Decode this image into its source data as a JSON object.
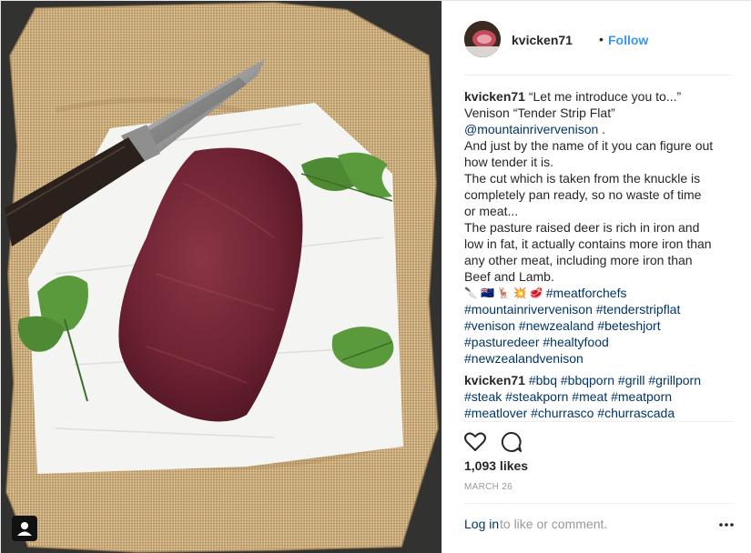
{
  "header": {
    "username": "kvicken71",
    "separator": "•",
    "follow_label": "Follow"
  },
  "caption": {
    "username": "kvicken71",
    "lines": [
      "“Let me introduce you to...”",
      "Venison “Tender Strip Flat”",
      "@mountainrivervenison",
      ".",
      "And just by the name of it you can figure out",
      "how tender it is.",
      "The cut which is taken from the knuckle is",
      "completely pan ready, so no waste of time",
      "or meat...",
      "The pasture raised deer is rich in iron and",
      "low in fat, it actually contains more iron than",
      "any other meat, including more iron than",
      "Beef and Lamb."
    ],
    "emojis": [
      "🔪",
      "🇳🇿",
      "🦌",
      "💥",
      "🥩"
    ],
    "hashtags": [
      "#meatforchefs",
      "#mountainrivervenison #tenderstripflat",
      "#venison #newzealand #beteshjort",
      "#pasturedeer #healtyfood",
      "#newzealandvenison"
    ]
  },
  "comment2": {
    "username": "kvicken71",
    "lines": [
      "#bbq #bbqporn #grill #grillporn",
      "#steak #steakporn #meat #meatporn",
      "#meatlover #churrasco #churrascada"
    ]
  },
  "actions": {
    "like_icon": "heart-icon",
    "comment_icon": "speech-bubble-icon",
    "likes": "1,093 likes",
    "date": "MARCH 26"
  },
  "footer": {
    "login_label": "Log in",
    "rest_text": "to like or comment.",
    "more_icon": "more-options-icon"
  },
  "colors": {
    "link": "#003569",
    "follow": "#3897f0",
    "muted": "#999999",
    "text": "#262626"
  }
}
